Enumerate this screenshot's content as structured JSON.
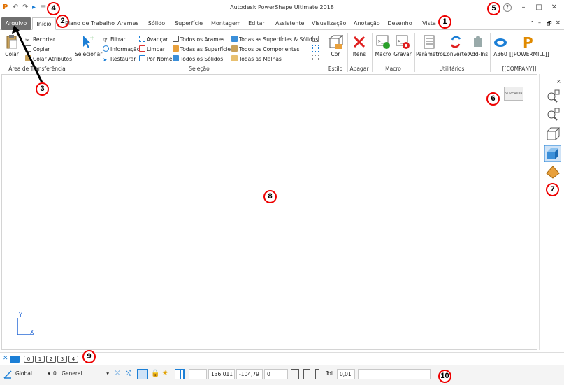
{
  "window": {
    "title": "Autodesk PowerShape Ultimate 2018",
    "help": "?",
    "minimize": "–",
    "maximize": "□",
    "close": "✕"
  },
  "quick_access": {
    "app_logo": "P",
    "undo": "↶",
    "redo": "↷",
    "select": "▸",
    "more": "≡"
  },
  "tabs": [
    {
      "label": "Arquivo"
    },
    {
      "label": "Início"
    },
    {
      "label": "Plano de Trabalho"
    },
    {
      "label": "Arames"
    },
    {
      "label": "Sólido"
    },
    {
      "label": "Superfície"
    },
    {
      "label": "Montagem"
    },
    {
      "label": "Editar"
    },
    {
      "label": "Assistente"
    },
    {
      "label": "Visualização"
    },
    {
      "label": "Anotação"
    },
    {
      "label": "Desenho"
    },
    {
      "label": "Vista"
    }
  ],
  "ribbon_ctrl": {
    "collapse": "⌃",
    "min": "–",
    "restore": "🗗",
    "close": "✕"
  },
  "ribbon": {
    "clipboard": {
      "paste": "Colar",
      "cut": "Recortar",
      "copy": "Copiar",
      "paste_attrs": "Colar Atributos",
      "label": "Área de Transferência"
    },
    "selection": {
      "select": "Selecionar",
      "filter": "Filtrar",
      "info": "Informação",
      "restore": "Restaurar",
      "advance": "Avançar",
      "clear": "Limpar",
      "by_name": "Por Nome",
      "all_wires": "Todos os Arames",
      "all_surfaces": "Todas as Superfícies",
      "all_solids": "Todos os Sólidos",
      "all_surf_solids": "Todas as Superfícies & Sólidos",
      "all_components": "Todos os Componentes",
      "all_meshes": "Todas as Malhas",
      "label": "Seleção"
    },
    "style": {
      "color": "Cor",
      "label": "Estilo"
    },
    "delete": {
      "items": "Itens",
      "label": "Apagar"
    },
    "macro": {
      "macro": "Macro",
      "record": "Gravar",
      "label": "Macro"
    },
    "utilities": {
      "params": "Parâmetros",
      "convert": "Converter",
      "addins": "Add-Ins",
      "label": "Utilitários"
    },
    "company": {
      "a360": "A360",
      "powermill": "[[POWERMILL]]",
      "label": "[[COMPANY]]"
    }
  },
  "canvas": {
    "view_cube": "SUPERIOR",
    "axis_y": "Y",
    "axis_x": "X",
    "close_pane": "×"
  },
  "callouts": [
    "1",
    "2",
    "3",
    "4",
    "5",
    "6",
    "7",
    "8",
    "9",
    "10"
  ],
  "levels": {
    "items": [
      "0",
      "1",
      "2",
      "3",
      "4"
    ]
  },
  "status": {
    "workplane": "Global",
    "level": "0 : General",
    "x": "136,011",
    "y": "-104,79",
    "z": "0",
    "tol_label": "Tol",
    "tol_value": "0,01"
  },
  "colors": {
    "accent_red": "#e00000",
    "file_tab": "#6f6f6f",
    "blue_icon": "#1c7fd6"
  }
}
